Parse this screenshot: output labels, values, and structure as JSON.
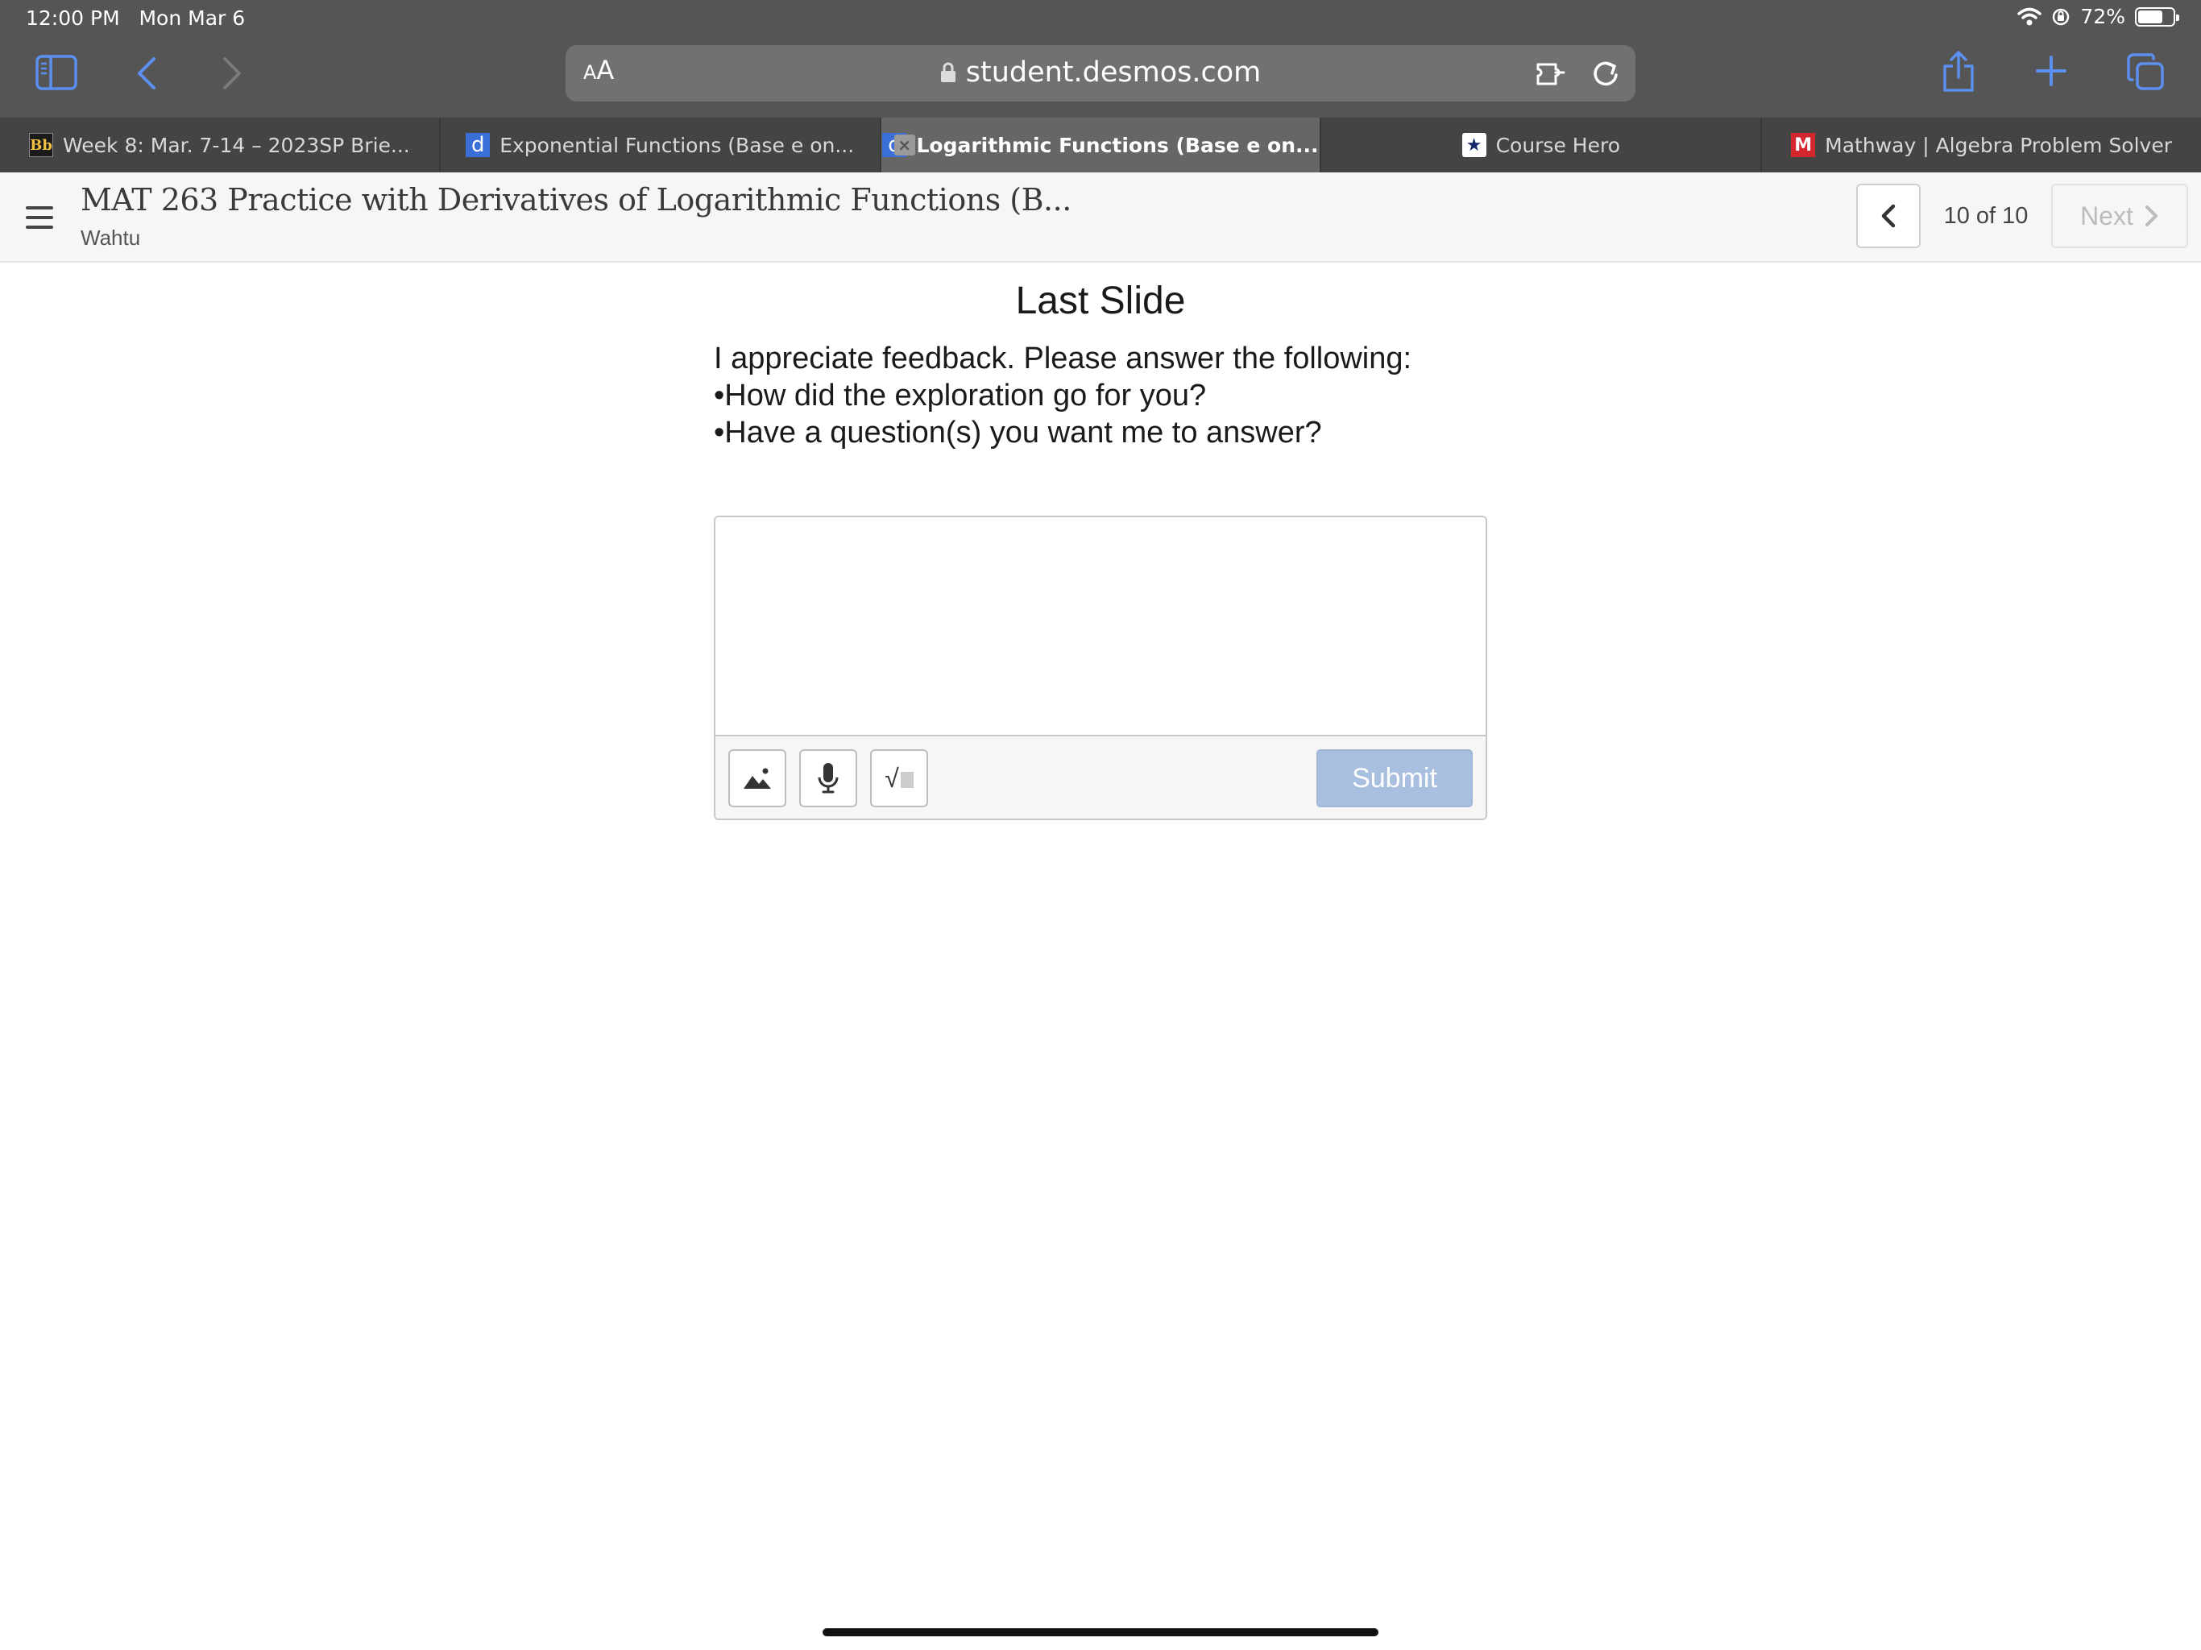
{
  "status_bar": {
    "time": "12:00 PM",
    "date": "Mon Mar 6",
    "battery": "72%",
    "battery_level": 0.72
  },
  "browser": {
    "address_aa_small": "A",
    "address_aa_big": "A",
    "url": "student.desmos.com",
    "icons": [
      "sidebar-icon",
      "back-icon",
      "forward-icon",
      "lock-icon",
      "extension-icon",
      "reload-icon",
      "share-icon",
      "new-tab-icon",
      "tabs-overview-icon"
    ]
  },
  "tabs": [
    {
      "favicon": "Bb",
      "label": "Week 8: Mar. 7-14 – 2023SP Brie...",
      "active": false
    },
    {
      "favicon": "d",
      "label": "Exponential Functions (Base e on...",
      "active": false
    },
    {
      "favicon": "d",
      "label": "Logarithmic Functions (Base e on...",
      "active": true,
      "close": "×"
    },
    {
      "favicon": "★",
      "label": "Course Hero",
      "active": false
    },
    {
      "favicon": "M",
      "label": "Mathway | Algebra Problem Solver",
      "active": false
    }
  ],
  "activity": {
    "title": "MAT 263 Practice with Derivatives of Logarithmic Functions (B...",
    "class_name": "Wahtu",
    "page_counter": "10 of 10",
    "next_label": "Next"
  },
  "slide": {
    "title": "Last Slide",
    "prompt_lines": [
      "I appreciate feedback. Please answer the following:",
      "•How did the exploration go for you?",
      "•Have a question(s) you want me to answer?"
    ],
    "response_value": "",
    "submit_label": "Submit",
    "math_tool_glyph": "√"
  },
  "colors": {
    "chrome_bg": "#555555",
    "tabbar_bg": "#444444",
    "active_tab_bg": "#666666",
    "browser_accent": "#5b8ff0",
    "submit_disabled": "#a9bfe0"
  }
}
